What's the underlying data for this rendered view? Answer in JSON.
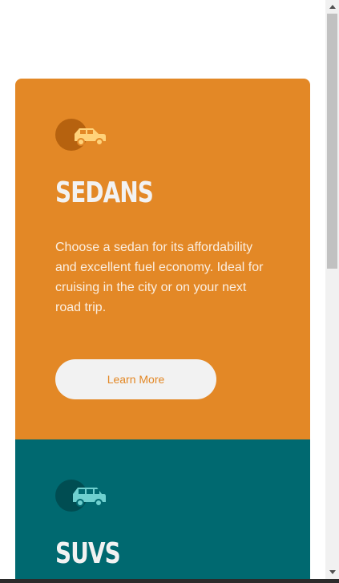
{
  "cards": [
    {
      "icon": "sedan-car-icon",
      "title": "SEDANS",
      "text": "Choose a sedan for its affordability and excellent fuel economy. Ideal for cruising in the city or on your next road trip.",
      "button_label": "Learn More",
      "color": "#e38826"
    },
    {
      "icon": "suv-car-icon",
      "title": "SUVS",
      "color": "#006970"
    }
  ],
  "colors": {
    "button_bg": "#f2f2f2",
    "text_light": "#f2f2f2"
  }
}
